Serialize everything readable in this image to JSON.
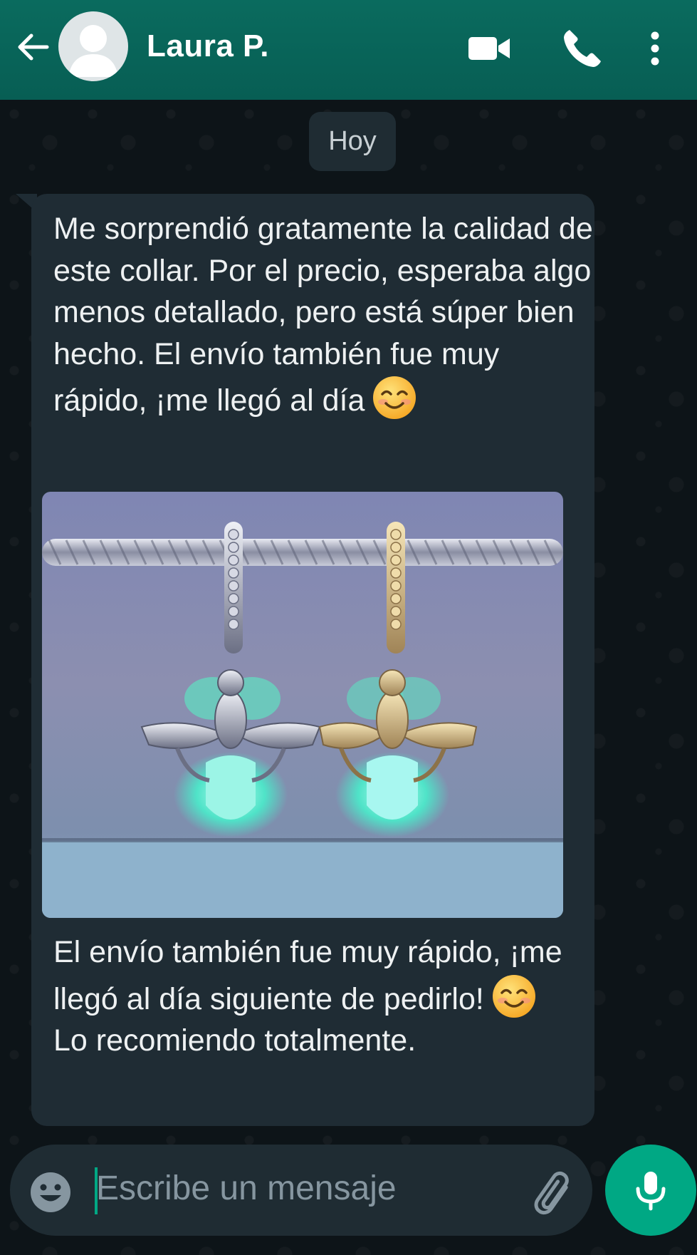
{
  "header": {
    "contact_name": "Laura P.",
    "back_icon": "arrow-left-icon",
    "avatar_icon": "default-avatar-icon",
    "video_icon": "video-call-icon",
    "call_icon": "phone-icon",
    "menu_icon": "more-vertical-icon",
    "color": "#075e54"
  },
  "chat": {
    "date_label": "Hoy",
    "message": {
      "text_top": "Me sorprendió gratamente la calidad de este collar. Por el precio, esperaba algo menos detallado, pero está súper bien hecho. El envío también fue muy rápido, ¡me llegó al día",
      "image_alt_icon": "photo-firefly-charms",
      "text_bottom_line1": "El envío también fue muy rápido, ¡me llegó al día siguiente de pedirlo!",
      "text_bottom_line2": "Lo recomiendo totalmente.",
      "emoji": "smiling-face-emoji"
    }
  },
  "composer": {
    "placeholder": "Escribe un mensaje",
    "emoji_icon": "emoji-icon",
    "attach_icon": "paperclip-icon",
    "mic_icon": "microphone-icon",
    "accent": "#00a884"
  }
}
